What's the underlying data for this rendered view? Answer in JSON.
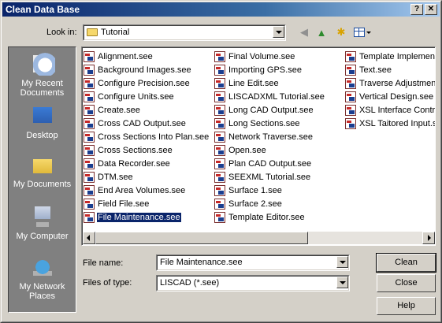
{
  "window": {
    "title": "Clean Data Base"
  },
  "titlebar_buttons": {
    "help": "?",
    "close": "✕"
  },
  "lookin": {
    "label": "Look in:",
    "value": "Tutorial"
  },
  "toolbar": {
    "back_icon": "back-arrow-icon",
    "up_icon": "up-folder-icon",
    "new_folder_icon": "new-folder-icon",
    "views_icon": "views-menu-icon"
  },
  "places": [
    {
      "label": "My Recent Documents",
      "icon": "recent-documents-icon"
    },
    {
      "label": "Desktop",
      "icon": "desktop-icon"
    },
    {
      "label": "My Documents",
      "icon": "my-documents-icon"
    },
    {
      "label": "My Computer",
      "icon": "my-computer-icon"
    },
    {
      "label": "My Network Places",
      "icon": "network-places-icon"
    }
  ],
  "files": {
    "column1": [
      "Alignment.see",
      "Background Images.see",
      "Configure Precision.see",
      "Configure Units.see",
      "Create.see",
      "Cross CAD Output.see",
      "Cross Sections Into Plan.see",
      "Cross Sections.see",
      "Data Recorder.see",
      "DTM.see",
      "End Area Volumes.see",
      "Field File.see",
      "File Maintenance.see"
    ],
    "column2": [
      "Final Volume.see",
      "Importing GPS.see",
      "Line Edit.see",
      "LISCADXML Tutorial.see",
      "Long CAD Output.see",
      "Long Sections.see",
      "Network Traverse.see",
      "Open.see",
      "Plan CAD Output.see",
      "SEEXML Tutorial.see",
      "Surface 1.see",
      "Surface 2.see",
      "Template Editor.see"
    ],
    "column3": [
      "Template Implement",
      "Text.see",
      "Traverse Adjustment",
      "Vertical Design.see",
      "XSL Interface Contro",
      "XSL Taitored Input.s"
    ],
    "selected": "File Maintenance.see"
  },
  "filename": {
    "label": "File name:",
    "value": "File Maintenance.see"
  },
  "filetype": {
    "label": "Files of type:",
    "value": "LISCAD (*.see)"
  },
  "buttons": {
    "clean": "Clean",
    "close": "Close",
    "help": "Help"
  }
}
